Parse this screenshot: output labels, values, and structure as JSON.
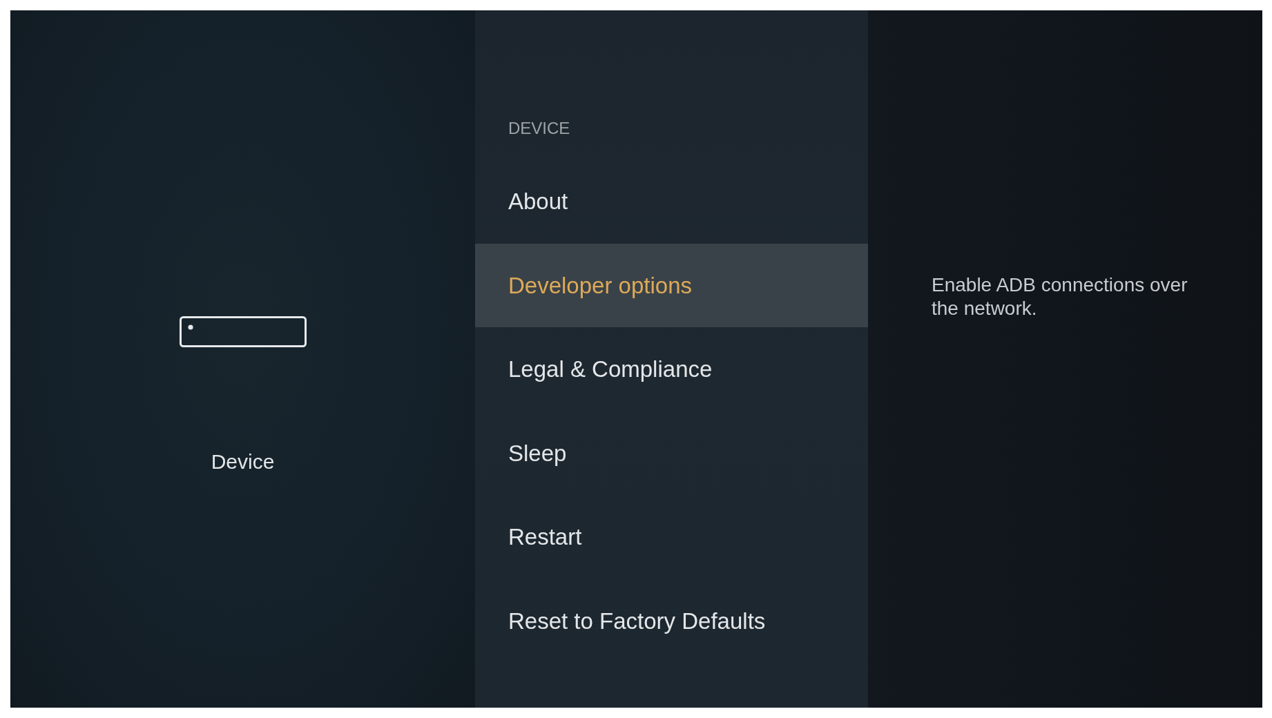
{
  "category": {
    "label": "Device"
  },
  "menu": {
    "heading": "DEVICE",
    "items": [
      {
        "label": "About",
        "selected": false
      },
      {
        "label": "Developer options",
        "selected": true
      },
      {
        "label": "Legal & Compliance",
        "selected": false
      },
      {
        "label": "Sleep",
        "selected": false
      },
      {
        "label": "Restart",
        "selected": false
      },
      {
        "label": "Reset to Factory Defaults",
        "selected": false
      }
    ]
  },
  "description": "Enable ADB connections over the network."
}
